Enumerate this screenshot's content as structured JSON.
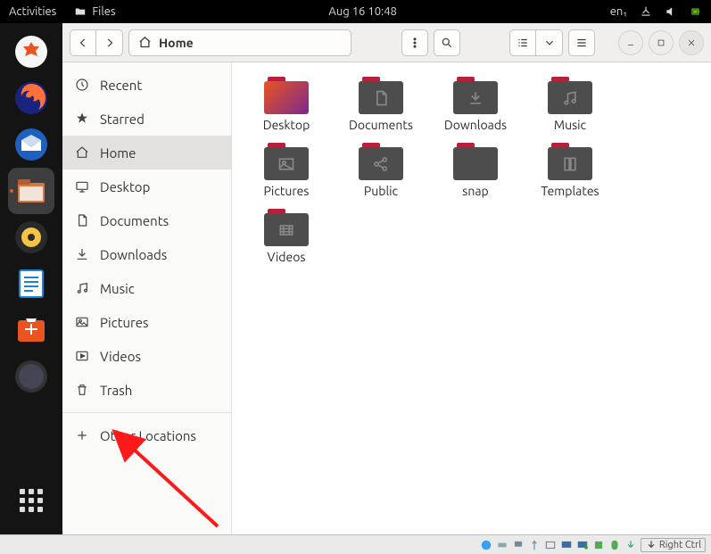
{
  "panel": {
    "activities": "Activities",
    "app_label": "Files",
    "clock": "Aug 16  10:48",
    "lang": "en₁"
  },
  "dock": {
    "items": [
      {
        "name": "settings",
        "color": "#f0f0f0"
      },
      {
        "name": "firefox",
        "color": "#ff7139"
      },
      {
        "name": "thunderbird",
        "color": "#1f5fbf"
      },
      {
        "name": "files",
        "color": "#8a5a44",
        "active": true
      },
      {
        "name": "rhythmbox",
        "color": "#2a2a2a"
      },
      {
        "name": "writer",
        "color": "#1a84d6"
      },
      {
        "name": "software",
        "color": "#e95420"
      },
      {
        "name": "help",
        "color": "#3a3a3a"
      }
    ]
  },
  "window": {
    "path_label": "Home",
    "sidebar": [
      {
        "icon": "recent",
        "label": "Recent"
      },
      {
        "icon": "star",
        "label": "Starred"
      },
      {
        "icon": "home",
        "label": "Home",
        "selected": true
      },
      {
        "icon": "desktop",
        "label": "Desktop"
      },
      {
        "icon": "documents",
        "label": "Documents"
      },
      {
        "icon": "downloads",
        "label": "Downloads"
      },
      {
        "icon": "music",
        "label": "Music"
      },
      {
        "icon": "pictures",
        "label": "Pictures"
      },
      {
        "icon": "videos",
        "label": "Videos"
      },
      {
        "icon": "trash",
        "label": "Trash"
      },
      {
        "icon": "plus",
        "label": "Other Locations",
        "sep_before": true
      }
    ],
    "files": [
      {
        "label": "Desktop",
        "glyph": "desktop"
      },
      {
        "label": "Documents",
        "glyph": "doc"
      },
      {
        "label": "Downloads",
        "glyph": "download"
      },
      {
        "label": "Music",
        "glyph": "music"
      },
      {
        "label": "Pictures",
        "glyph": "picture"
      },
      {
        "label": "Public",
        "glyph": "share"
      },
      {
        "label": "snap",
        "glyph": "none"
      },
      {
        "label": "Templates",
        "glyph": "template"
      },
      {
        "label": "Videos",
        "glyph": "video"
      }
    ]
  },
  "vm_bar": {
    "key_label": "Right Ctrl"
  }
}
